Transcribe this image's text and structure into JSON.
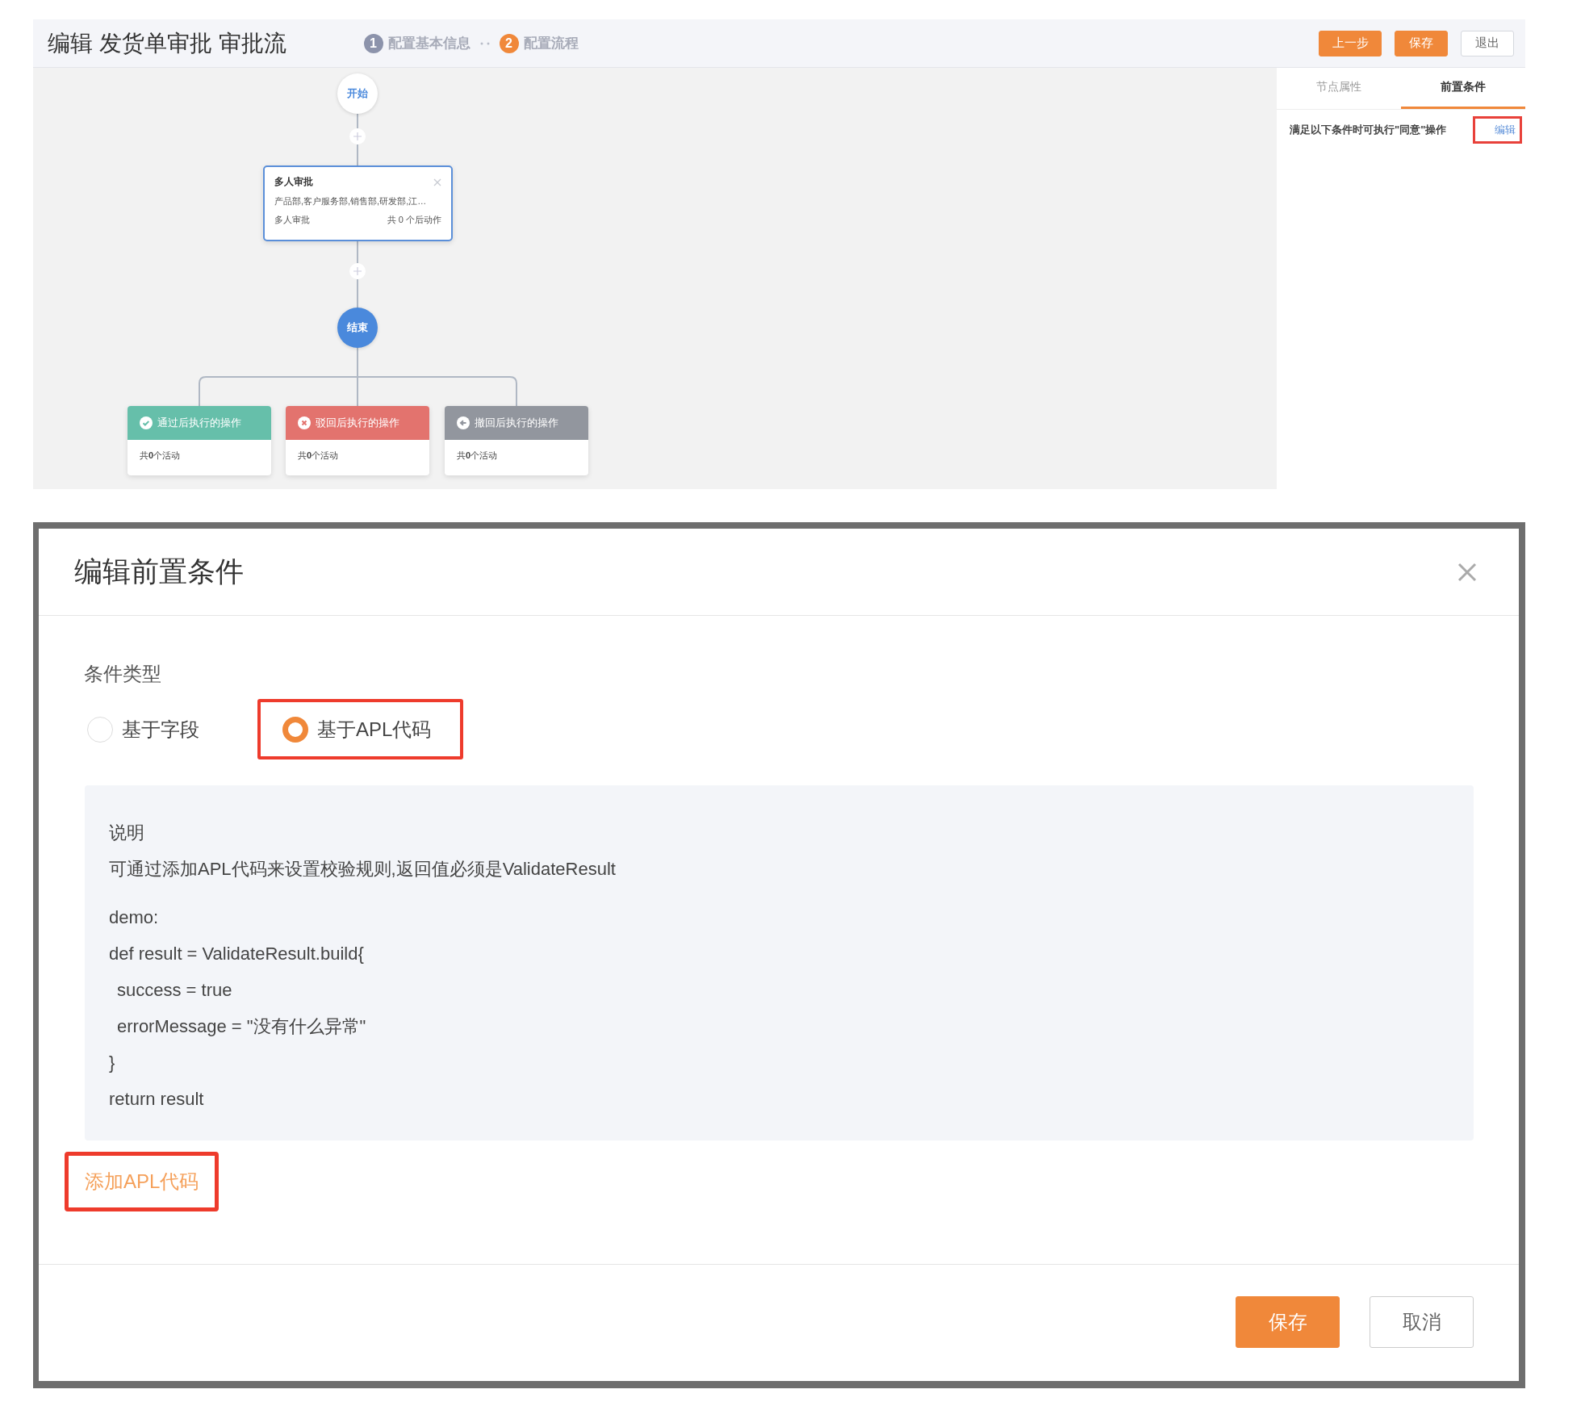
{
  "editor": {
    "header": {
      "title": "编辑 发货单审批 审批流",
      "steps": [
        {
          "number": "1",
          "label": "配置基本信息",
          "selected": false
        },
        {
          "number": "2",
          "label": "配置流程",
          "selected": true
        }
      ],
      "buttons": [
        {
          "label": "上一步",
          "kind": "primary"
        },
        {
          "label": "保存",
          "kind": "primary"
        },
        {
          "label": "退出",
          "kind": "default"
        }
      ]
    },
    "flow": {
      "start": "开始",
      "approval_node": {
        "title": "多人审批",
        "assignees": "产品部,客户服务部,销售部,研发部,江…",
        "type": "多人审批",
        "actions": "共 0 个后动作"
      },
      "end": "结束",
      "outcomes": [
        {
          "kind": "approve",
          "title": "通过后执行的操作",
          "count": "共**0**个活动",
          "color": "#66bfaa"
        },
        {
          "kind": "reject",
          "title": "驳回后执行的操作",
          "count": "共**0**个活动",
          "color": "#e3736e"
        },
        {
          "kind": "revoke",
          "title": "撤回后执行的操作",
          "count": "共**0**个活动",
          "color": "#92969e"
        }
      ]
    },
    "panel": {
      "tabs": [
        {
          "label": "节点属性",
          "selected": false
        },
        {
          "label": "前置条件",
          "selected": true
        }
      ],
      "condition_text": "满足以下条件时可执行\"同意\"操作",
      "edit_link": {
        "label": "编辑",
        "highlighted": true
      }
    }
  },
  "dialog": {
    "title": "编辑前置条件",
    "condition_type_label": "条件类型",
    "options": [
      {
        "label": "基于字段",
        "selected": false,
        "highlighted": false
      },
      {
        "label": "基于APL代码",
        "selected": true,
        "highlighted": true
      }
    ],
    "info": {
      "heading": "说明",
      "description": "可通过添加APL代码来设置校验规则,返回值必须是ValidateResult",
      "code": [
        {
          "text": "demo:",
          "indented": false
        },
        {
          "text": "def result = ValidateResult.build{",
          "indented": false
        },
        {
          "text": "success = true",
          "indented": true
        },
        {
          "text": "errorMessage = \"没有什么异常\"",
          "indented": true
        },
        {
          "text": "}",
          "indented": false
        },
        {
          "text": "return result",
          "indented": false
        }
      ]
    },
    "add_link": {
      "label": "添加APL代码",
      "highlighted": true
    },
    "buttons": [
      {
        "label": "保存",
        "kind": "primary"
      },
      {
        "label": "取消",
        "kind": "default"
      }
    ]
  }
}
